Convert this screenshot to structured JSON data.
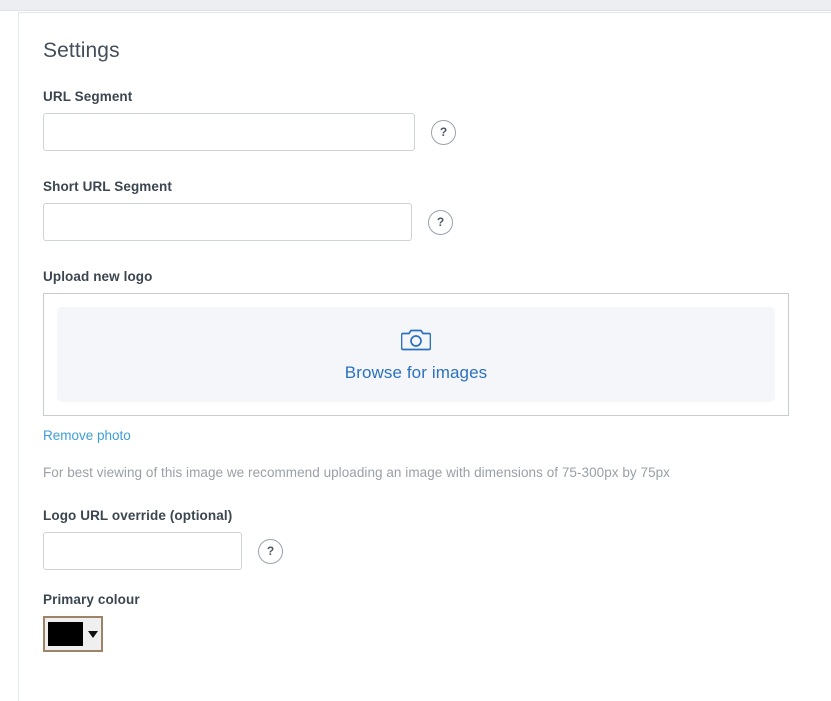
{
  "page": {
    "title": "Settings"
  },
  "fields": {
    "url_segment": {
      "label": "URL Segment",
      "value": "",
      "placeholder": "",
      "help_glyph": "?",
      "help_name": "question-mark-icon"
    },
    "short_url_segment": {
      "label": "Short URL Segment",
      "value": "",
      "placeholder": "",
      "help_glyph": "?"
    },
    "upload_logo": {
      "label": "Upload new logo",
      "browse_text": "Browse for images",
      "icon": "camera-icon",
      "remove_link": "Remove photo",
      "hint": "For best viewing of this image we recommend uploading an image with dimensions of 75-300px by 75px"
    },
    "logo_url_override": {
      "label": "Logo URL override (optional)",
      "value": "",
      "placeholder": "",
      "help_glyph": "?"
    },
    "primary_colour": {
      "label": "Primary colour",
      "value": "#000000",
      "caret": "▼"
    }
  },
  "colors": {
    "accent_blue": "#2b71bd",
    "link_blue": "#3d9ed6",
    "label_dark": "#3c4650",
    "hint_gray": "#9aa0a7",
    "dropzone_bg": "#f4f6fa",
    "picker_border": "#9d8466",
    "swatch": "#000000",
    "top_strip": "#eceef1"
  }
}
